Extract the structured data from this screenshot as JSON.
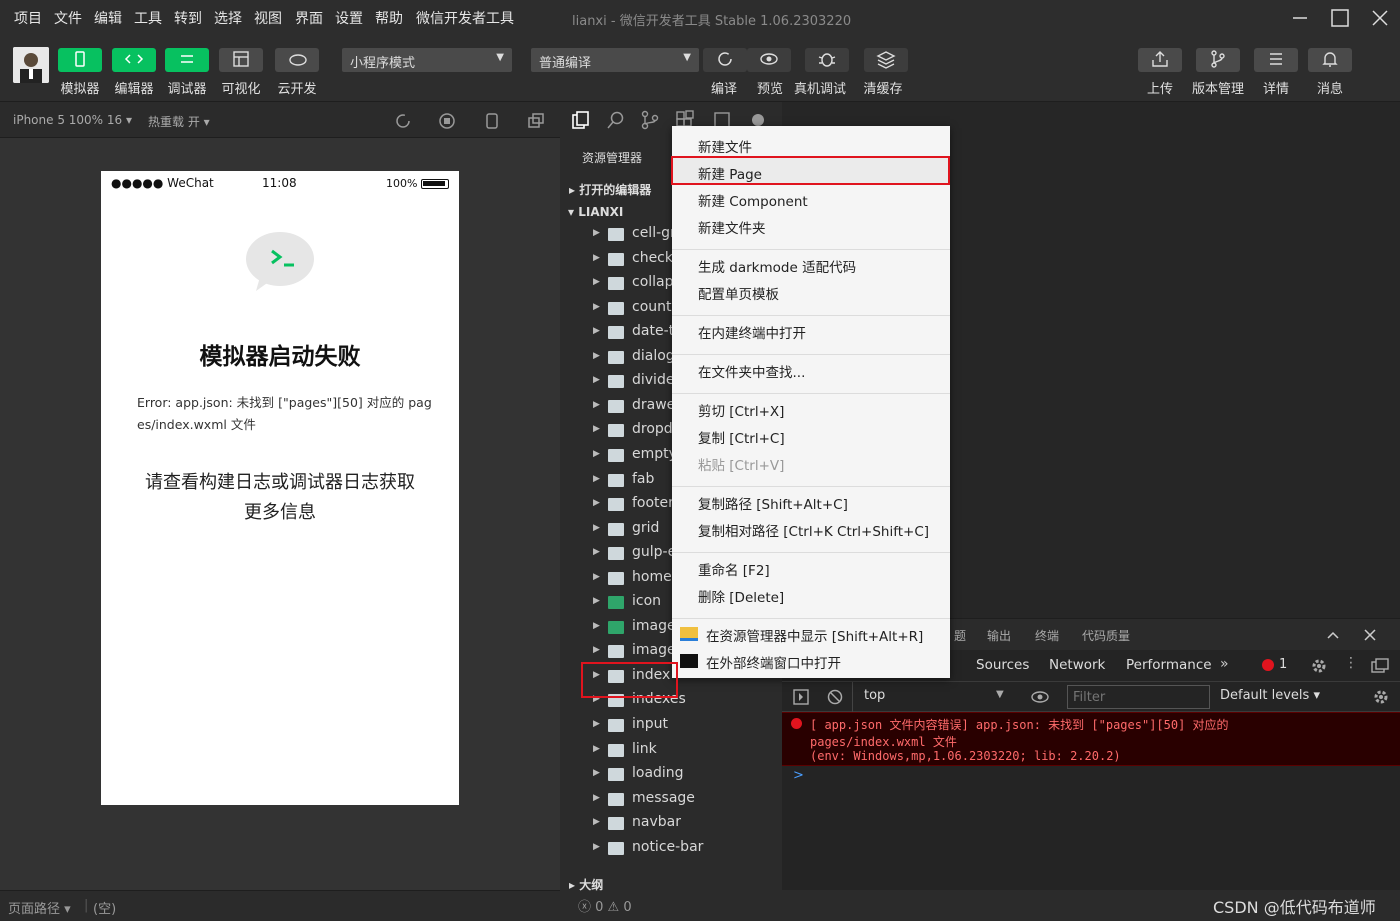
{
  "menubar": {
    "items": [
      "项目",
      "文件",
      "编辑",
      "工具",
      "转到",
      "选择",
      "视图",
      "界面",
      "设置",
      "帮助",
      "微信开发者工具"
    ],
    "window_title": "lianxi - 微信开发者工具 Stable 1.06.2303220"
  },
  "toolbar": {
    "left_buttons": [
      {
        "label": "模拟器",
        "icon": "phone-icon",
        "style": "green"
      },
      {
        "label": "编辑器",
        "icon": "code-icon",
        "style": "green"
      },
      {
        "label": "调试器",
        "icon": "debug-icon",
        "style": "green"
      },
      {
        "label": "可视化",
        "icon": "layout-icon",
        "style": "gray"
      },
      {
        "label": "云开发",
        "icon": "cloud-icon",
        "style": "gray"
      }
    ],
    "mode_select": "小程序模式",
    "compile_select": "普通编译",
    "mid_buttons": [
      {
        "label": "编译",
        "icon": "refresh-icon"
      },
      {
        "label": "预览",
        "icon": "eye-icon"
      },
      {
        "label": "真机调试",
        "icon": "bug-icon"
      },
      {
        "label": "清缓存",
        "icon": "layers-icon"
      }
    ],
    "right_buttons": [
      {
        "label": "上传",
        "icon": "upload-icon"
      },
      {
        "label": "版本管理",
        "icon": "branch-icon"
      },
      {
        "label": "详情",
        "icon": "menu-icon"
      },
      {
        "label": "消息",
        "icon": "bell-icon"
      }
    ]
  },
  "simulator": {
    "device": "iPhone 5 100% 16",
    "hot_reload": "热重载 开",
    "status": {
      "carrier": "●●●●● WeChat",
      "time": "11:08",
      "battery": "100%"
    },
    "error_title": "模拟器启动失败",
    "error_detail_1": "Error: app.json: 未找到 [\"pages\"][50] 对应的 pag",
    "error_detail_2": "es/index.wxml 文件",
    "hint_1": "请查看构建日志或调试器日志获取",
    "hint_2": "更多信息"
  },
  "bottombar": {
    "path_label": "页面路径",
    "path_value": "(空)"
  },
  "explorer": {
    "header": "资源管理器",
    "open_editors": "打开的编辑器",
    "project": "LIANXI",
    "outline": "大纲",
    "status": "0 0",
    "items": [
      {
        "name": "cell-gr",
        "green": false
      },
      {
        "name": "checkl",
        "green": false
      },
      {
        "name": "collap",
        "green": false
      },
      {
        "name": "count-",
        "green": false
      },
      {
        "name": "date-t",
        "green": false
      },
      {
        "name": "dialog",
        "green": false
      },
      {
        "name": "divide",
        "green": false
      },
      {
        "name": "drawe",
        "green": false
      },
      {
        "name": "dropd",
        "green": false
      },
      {
        "name": "empty",
        "green": false
      },
      {
        "name": "fab",
        "green": false
      },
      {
        "name": "footer",
        "green": false
      },
      {
        "name": "grid",
        "green": false
      },
      {
        "name": "gulp-e",
        "green": false
      },
      {
        "name": "home",
        "green": false
      },
      {
        "name": "icon",
        "green": true
      },
      {
        "name": "image",
        "green": true
      },
      {
        "name": "image",
        "green": false
      },
      {
        "name": "index",
        "green": false
      },
      {
        "name": "indexes",
        "green": false
      },
      {
        "name": "input",
        "green": false
      },
      {
        "name": "link",
        "green": false
      },
      {
        "name": "loading",
        "green": false
      },
      {
        "name": "message",
        "green": false
      },
      {
        "name": "navbar",
        "green": false
      },
      {
        "name": "notice-bar",
        "green": false
      }
    ]
  },
  "context_menu": {
    "items": [
      {
        "label": "新建文件"
      },
      {
        "label": "新建 Page",
        "highlight": true
      },
      {
        "label": "新建 Component"
      },
      {
        "label": "新建文件夹"
      },
      {
        "sep": true
      },
      {
        "label": "生成 darkmode 适配代码"
      },
      {
        "label": "配置单页模板"
      },
      {
        "sep": true
      },
      {
        "label": "在内建终端中打开"
      },
      {
        "sep": true
      },
      {
        "label": "在文件夹中查找..."
      },
      {
        "sep": true
      },
      {
        "label": "剪切   [Ctrl+X]"
      },
      {
        "label": "复制   [Ctrl+C]"
      },
      {
        "label": "粘贴   [Ctrl+V]",
        "disabled": true
      },
      {
        "sep": true
      },
      {
        "label": "复制路径   [Shift+Alt+C]"
      },
      {
        "label": "复制相对路径   [Ctrl+K Ctrl+Shift+C]"
      },
      {
        "sep": true
      },
      {
        "label": "重命名   [F2]"
      },
      {
        "label": "删除   [Delete]"
      },
      {
        "sep": true
      },
      {
        "label": "在资源管理器中显示   [Shift+Alt+R]",
        "icon": "folder-icon"
      },
      {
        "label": "在外部终端窗口中打开",
        "icon": "terminal-icon"
      }
    ]
  },
  "debugger": {
    "panel_tabs": [
      "题",
      "输出",
      "终端",
      "代码质量"
    ],
    "dev_tabs": [
      "Sources",
      "Network",
      "Performance"
    ],
    "error_count": "1",
    "context": "top",
    "filter_placeholder": "Filter",
    "levels": "Default levels",
    "error_line1": "[ app.json 文件内容错误] app.json: 未找到 [\"pages\"][50] 对应的",
    "error_line2": "pages/index.wxml 文件",
    "error_line3": "(env: Windows,mp,1.06.2303220; lib: 2.20.2)",
    "prompt": ">"
  },
  "watermark": "CSDN @低代码布道师"
}
